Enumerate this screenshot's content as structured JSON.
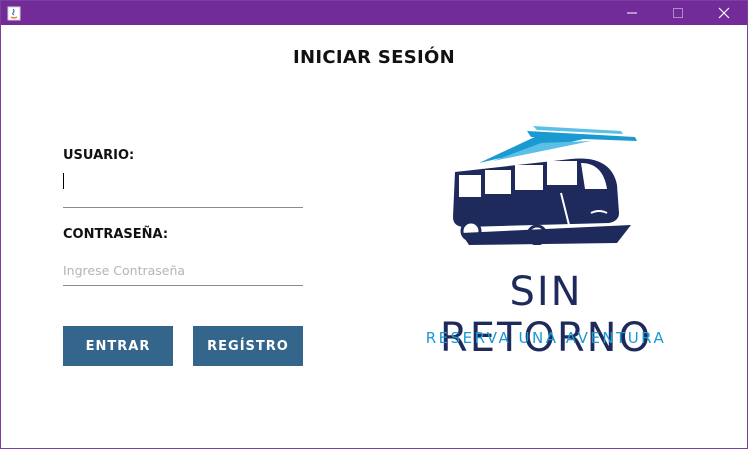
{
  "window": {
    "title": "",
    "titlebar_color": "#722b98",
    "controls": {
      "minimize_icon": "minimize-icon",
      "maximize_icon": "maximize-icon",
      "close_icon": "close-icon"
    }
  },
  "login": {
    "heading": "INICIAR SESIÓN",
    "username": {
      "label": "USUARIO:",
      "value": ""
    },
    "password": {
      "label": "CONTRASEÑA:",
      "placeholder": "Ingrese Contraseña",
      "value": ""
    },
    "buttons": {
      "enter": "ENTRAR",
      "register": "REGÍSTRO"
    },
    "button_color": "#34658a"
  },
  "brand": {
    "name": "SIN RETORNO",
    "slogan": "RESERVA UNA AVENTURA",
    "name_color": "#1f2a5c",
    "slogan_color": "#1a9ad1",
    "logo_icon": "bus-icon"
  }
}
